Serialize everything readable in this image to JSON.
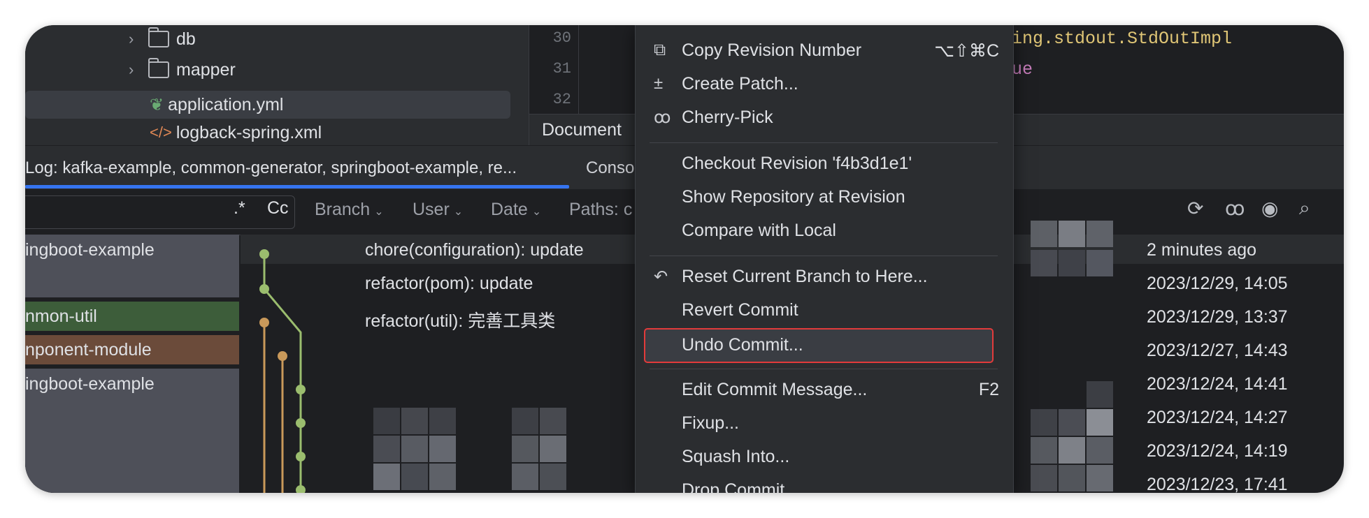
{
  "tree": {
    "items": [
      {
        "label": "db",
        "type": "folder"
      },
      {
        "label": "mapper",
        "type": "folder"
      },
      {
        "label": "application.yml",
        "type": "spring-config"
      },
      {
        "label": "logback-spring.xml",
        "type": "xml"
      }
    ]
  },
  "editor": {
    "lines": [
      "30",
      "31",
      "32"
    ],
    "code_line1": "ing.stdout.StdOutImpl",
    "code_line2": "ue",
    "doc_tab": "Document"
  },
  "log_tab": {
    "label": "Log: kafka-example, common-generator, springboot-example, re...",
    "console": "Conso"
  },
  "filters": {
    "regex": ".*",
    "case": "Cc",
    "branch": "Branch",
    "user": "User",
    "date": "Date",
    "paths": "Paths: c"
  },
  "branches": [
    {
      "label": "ingboot-example",
      "color": "#4e5059"
    },
    {
      "label": "nmon-util",
      "color": "#3d5d3a"
    },
    {
      "label": "nponent-module",
      "color": "#6b4b3a"
    },
    {
      "label": "ingboot-example",
      "color": "#4e5059"
    }
  ],
  "commits": [
    {
      "message": "chore(configuration): update"
    },
    {
      "message": "refactor(pom): update"
    },
    {
      "message": "refactor(util): 完善工具类"
    }
  ],
  "dates": [
    "2 minutes ago",
    "2023/12/29, 14:05",
    "2023/12/29, 13:37",
    "2023/12/27, 14:43",
    "2023/12/24, 14:41",
    "2023/12/24, 14:27",
    "2023/12/24, 14:19",
    "2023/12/23, 17:41"
  ],
  "menu": {
    "items": [
      {
        "label": "Copy Revision Number",
        "shortcut": "⌥⇧⌘C",
        "icon": "copy-icon"
      },
      {
        "label": "Create Patch...",
        "shortcut": "",
        "icon": "patch-icon"
      },
      {
        "label": "Cherry-Pick",
        "shortcut": "",
        "icon": "cherry-icon"
      },
      {
        "label": "Checkout Revision 'f4b3d1e1'",
        "shortcut": ""
      },
      {
        "label": "Show Repository at Revision",
        "shortcut": ""
      },
      {
        "label": "Compare with Local",
        "shortcut": ""
      },
      {
        "label": "Reset Current Branch to Here...",
        "shortcut": "",
        "icon": "reset-icon"
      },
      {
        "label": "Revert Commit",
        "shortcut": ""
      },
      {
        "label": "Undo Commit...",
        "shortcut": ""
      },
      {
        "label": "Edit Commit Message...",
        "shortcut": "F2"
      },
      {
        "label": "Fixup...",
        "shortcut": ""
      },
      {
        "label": "Squash Into...",
        "shortcut": ""
      },
      {
        "label": "Drop Commit",
        "shortcut": ""
      }
    ]
  },
  "colors": {
    "accent": "#3574f0",
    "highlight_border": "#e23b3b",
    "graph_green": "#9bbd6e",
    "graph_orange": "#c9995a"
  }
}
